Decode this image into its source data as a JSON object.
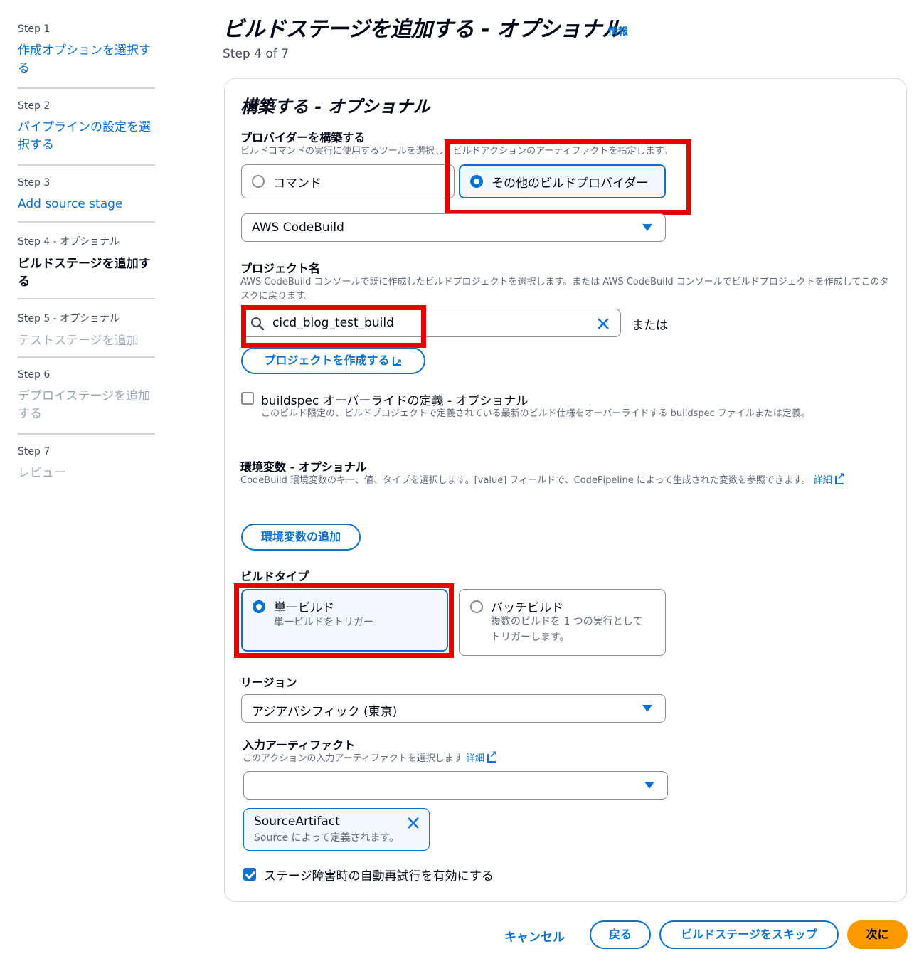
{
  "nav": {
    "steps": [
      {
        "num": "Step 1",
        "label": "作成オプションを選択する"
      },
      {
        "num": "Step 2",
        "label": "パイプラインの設定を選択する"
      },
      {
        "num": "Step 3",
        "label": "Add source stage"
      },
      {
        "num": "Step 4 - オプショナル",
        "label": "ビルドステージを追加する"
      },
      {
        "num": "Step 5 - オプショナル",
        "label": "テストステージを追加"
      },
      {
        "num": "Step 6",
        "label": "デプロイステージを追加する"
      },
      {
        "num": "Step 7",
        "label": "レビュー"
      }
    ]
  },
  "header": {
    "title": "ビルドステージを追加する - オプショナル",
    "info": "情報",
    "step": "Step 4 of 7"
  },
  "build": {
    "section_title": "構築する - オプショナル",
    "provider_label": "プロバイダーを構築する",
    "provider_desc": "ビルドコマンドの実行に使用するツールを選択し、ビルドアクションのアーティファクトを指定します。",
    "option_command": "コマンド",
    "option_other": "その他のビルドプロバイダー",
    "provider_select": "AWS CodeBuild",
    "project_label": "プロジェクト名",
    "project_desc": "AWS CodeBuild コンソールで既に作成したビルドプロジェクトを選択します。または AWS CodeBuild コンソールでビルドプロジェクトを作成してこのタスクに戻ります。",
    "project_value": "cicd_blog_test_build",
    "or_text": "または",
    "create_project": "プロジェクトを作成する",
    "buildspec_label": "buildspec オーバーライドの定義 - オプショナル",
    "buildspec_desc": "このビルド限定の、ビルドプロジェクトで定義されている最新のビルド仕様をオーバーライドする buildspec ファイルまたは定義。",
    "env_label": "環境変数 - オプショナル",
    "env_desc": "CodeBuild 環境変数のキー、値、タイプを選択します。[value] フィールドで、CodePipeline によって生成された変数を参照できます。",
    "env_detail": "詳細",
    "add_env": "環境変数の追加",
    "build_type_label": "ビルドタイプ",
    "single_build": "単一ビルド",
    "single_build_desc": "単一ビルドをトリガー",
    "batch_build": "バッチビルド",
    "batch_build_desc": "複数のビルドを 1 つの実行としてトリガーします。",
    "region_label": "リージョン",
    "region_value": "アジアパシフィック (東京)",
    "input_label": "入力アーティファクト",
    "input_desc": "このアクションの入力アーティファクトを選択します",
    "input_detail": "詳細",
    "artifact_name": "SourceArtifact",
    "artifact_desc": "Source によって定義されます。",
    "retry_label": "ステージ障害時の自動再試行を有効にする"
  },
  "footer": {
    "cancel": "キャンセル",
    "back": "戻る",
    "skip": "ビルドステージをスキップ",
    "next": "次に"
  },
  "colors": {
    "accent": "#0972d3",
    "primary": "#ff9900",
    "highlight": "#e60000"
  }
}
